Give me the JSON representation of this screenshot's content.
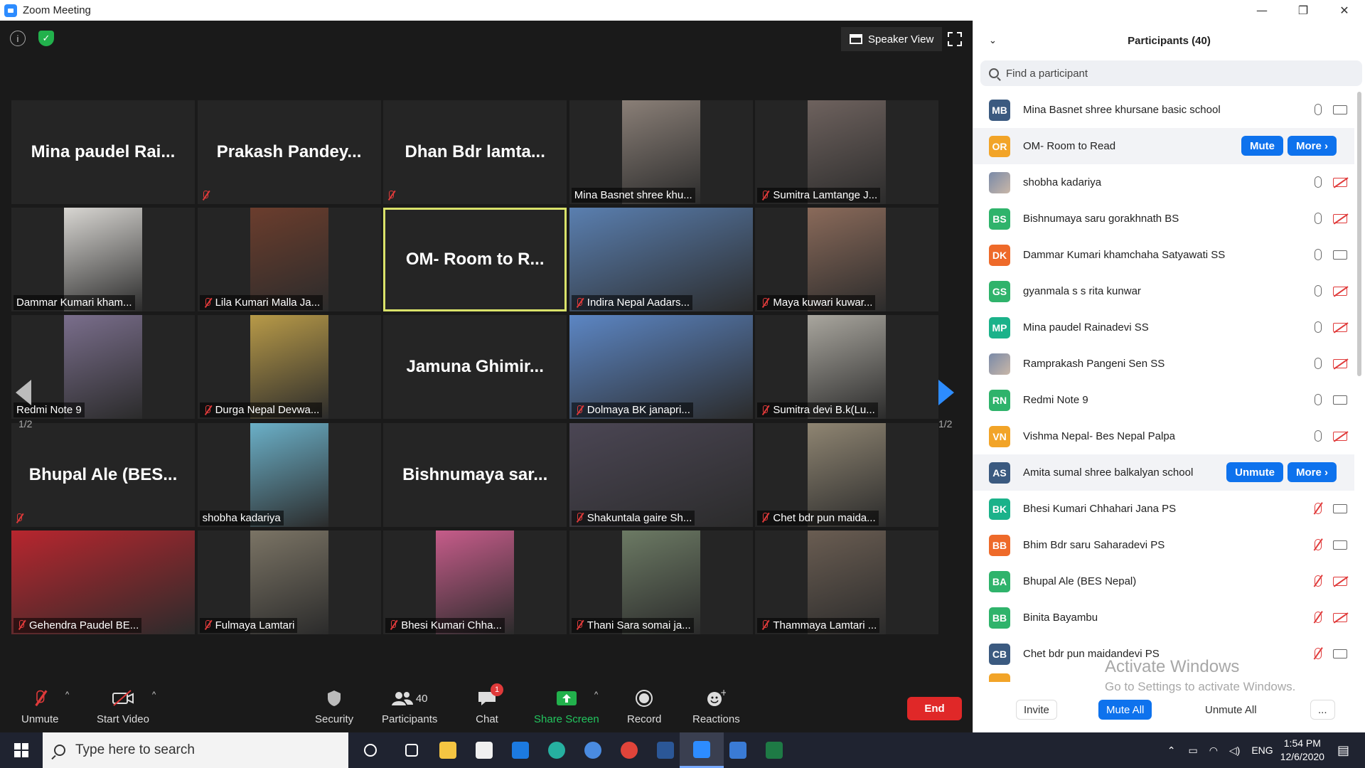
{
  "window": {
    "title": "Zoom Meeting",
    "min": "—",
    "max": "❐",
    "close": "✕"
  },
  "top": {
    "speaker_view": "Speaker View"
  },
  "pager": {
    "left": "1/2",
    "right": "1/2"
  },
  "tiles": [
    {
      "name": "Mina paudel Rai...",
      "label": "",
      "muted": false,
      "video": false
    },
    {
      "name": "Prakash Pandey...",
      "label": "",
      "muted": true,
      "video": false
    },
    {
      "name": "Dhan Bdr lamta...",
      "label": "",
      "muted": true,
      "video": false
    },
    {
      "name": "",
      "label": "Mina Basnet shree khu...",
      "muted": false,
      "video": true,
      "color": "#8a7f77"
    },
    {
      "name": "",
      "label": "Sumitra Lamtange J...",
      "muted": true,
      "video": true,
      "color": "#6e625e"
    },
    {
      "name": "",
      "label": "Dammar Kumari kham...",
      "muted": false,
      "video": true,
      "color": "#d8d6d2"
    },
    {
      "name": "",
      "label": "Lila Kumari Malla Ja...",
      "muted": true,
      "video": true,
      "color": "#6b3d2d"
    },
    {
      "name": "OM- Room to R...",
      "label": "",
      "muted": false,
      "video": false,
      "active": true
    },
    {
      "name": "",
      "label": "Indira Nepal Aadars...",
      "muted": true,
      "video": true,
      "color": "#5a7fb0"
    },
    {
      "name": "",
      "label": "Maya kuwari kuwar...",
      "muted": true,
      "video": true,
      "color": "#8a6a5a"
    },
    {
      "name": "",
      "label": "Redmi Note 9",
      "muted": false,
      "video": true,
      "color": "#7a6e8c"
    },
    {
      "name": "",
      "label": "Durga Nepal Devwa...",
      "muted": true,
      "video": true,
      "color": "#b89a48"
    },
    {
      "name": "Jamuna Ghimir...",
      "label": "",
      "muted": false,
      "video": false
    },
    {
      "name": "",
      "label": "Dolmaya BK janapri...",
      "muted": true,
      "video": true,
      "color": "#5c86c4"
    },
    {
      "name": "",
      "label": "Sumitra devi B.k(Lu...",
      "muted": true,
      "video": true,
      "color": "#a9a69e"
    },
    {
      "name": "Bhupal Ale (BES...",
      "label": "",
      "muted": true,
      "video": false
    },
    {
      "name": "",
      "label": "shobha kadariya",
      "muted": false,
      "video": true,
      "color": "#6bb0c8"
    },
    {
      "name": "Bishnumaya sar...",
      "label": "",
      "muted": false,
      "video": false
    },
    {
      "name": "",
      "label": "Shakuntala gaire Sh...",
      "muted": true,
      "video": true,
      "color": "#4b4654"
    },
    {
      "name": "",
      "label": "Chet bdr pun maida...",
      "muted": true,
      "video": true,
      "color": "#8f8572"
    },
    {
      "name": "",
      "label": "Gehendra Paudel BE...",
      "muted": true,
      "video": true,
      "color": "#b8262e"
    },
    {
      "name": "",
      "label": "Fulmaya Lamtari",
      "muted": true,
      "video": true,
      "color": "#7b7465"
    },
    {
      "name": "",
      "label": "Bhesi Kumari Chha...",
      "muted": true,
      "video": true,
      "color": "#c65c8a"
    },
    {
      "name": "",
      "label": "Thani Sara somai ja...",
      "muted": true,
      "video": true,
      "color": "#6c7a64"
    },
    {
      "name": "",
      "label": "Thammaya Lamtari ...",
      "muted": true,
      "video": true,
      "color": "#6a5d52"
    }
  ],
  "toolbar": {
    "unmute": "Unmute",
    "start_video": "Start Video",
    "security": "Security",
    "participants": "Participants",
    "participants_count": "40",
    "chat": "Chat",
    "chat_badge": "1",
    "share_screen": "Share Screen",
    "record": "Record",
    "reactions": "Reactions",
    "end": "End"
  },
  "panel": {
    "title": "Participants (40)",
    "search_placeholder": "Find a participant",
    "participants": [
      {
        "initials": "MB",
        "name": "Mina Basnet shree khursane basic school",
        "color": "#3b5a80",
        "mic": "on",
        "cam": "on"
      },
      {
        "initials": "OR",
        "name": "OM- Room to Read",
        "color": "#f2a428",
        "buttons": [
          "Mute",
          "More ›"
        ],
        "highlight": true
      },
      {
        "initials": "",
        "name": "shobha kadariya",
        "image": true,
        "mic": "on",
        "cam": "off"
      },
      {
        "initials": "BS",
        "name": "Bishnumaya saru gorakhnath BS",
        "color": "#2fb36b",
        "mic": "on",
        "cam": "off"
      },
      {
        "initials": "DK",
        "name": "Dammar Kumari khamchaha Satyawati SS",
        "color": "#ee6a2a",
        "mic": "on",
        "cam": "on"
      },
      {
        "initials": "GS",
        "name": "gyanmala s s rita kunwar",
        "color": "#2fb36b",
        "mic": "on",
        "cam": "off"
      },
      {
        "initials": "MP",
        "name": "Mina paudel Rainadevi SS",
        "color": "#1bb28a",
        "mic": "on",
        "cam": "off"
      },
      {
        "initials": "",
        "name": "Ramprakash Pangeni Sen SS",
        "image": true,
        "mic": "on",
        "cam": "off"
      },
      {
        "initials": "RN",
        "name": "Redmi Note 9",
        "color": "#2fb36b",
        "mic": "on",
        "cam": "on"
      },
      {
        "initials": "VN",
        "name": "Vishma Nepal- Bes Nepal Palpa",
        "color": "#f2a428",
        "mic": "on",
        "cam": "off"
      },
      {
        "initials": "AS",
        "name": "Amita sumal shree balkalyan school",
        "color": "#3b5a80",
        "buttons": [
          "Unmute",
          "More ›"
        ],
        "highlight": true
      },
      {
        "initials": "BK",
        "name": "Bhesi Kumari Chhahari Jana PS",
        "color": "#1bb28a",
        "mic": "off",
        "cam": "on"
      },
      {
        "initials": "BB",
        "name": "Bhim Bdr saru Saharadevi PS",
        "color": "#ee6a2a",
        "mic": "off",
        "cam": "on"
      },
      {
        "initials": "BA",
        "name": "Bhupal Ale (BES Nepal)",
        "color": "#2fb36b",
        "mic": "off",
        "cam": "off"
      },
      {
        "initials": "BB",
        "name": "Binita Bayambu",
        "color": "#2fb36b",
        "mic": "off",
        "cam": "off"
      },
      {
        "initials": "CB",
        "name": "Chet bdr pun maidandevi PS",
        "color": "#3b5a80",
        "mic": "off",
        "cam": "on"
      }
    ],
    "footer": {
      "invite": "Invite",
      "mute_all": "Mute All",
      "unmute_all": "Unmute All",
      "more": "..."
    },
    "watermark": {
      "line1": "Activate Windows",
      "line2": "Go to Settings to activate Windows."
    }
  },
  "taskbar": {
    "search_placeholder": "Type here to search",
    "lang": "ENG",
    "time": "1:54 PM",
    "date": "12/6/2020",
    "apps": [
      {
        "name": "task-view-icon",
        "color": "#ffffff"
      },
      {
        "name": "file-explorer-icon",
        "color": "#f5c542"
      },
      {
        "name": "store-icon",
        "color": "#f0f0f0"
      },
      {
        "name": "mail-icon",
        "color": "#1c7ae0"
      },
      {
        "name": "edge-icon",
        "color": "#26b0a0"
      },
      {
        "name": "chromium-icon",
        "color": "#4a8be0"
      },
      {
        "name": "chrome-icon",
        "color": "#e0443a"
      },
      {
        "name": "word-icon",
        "color": "#2b5797"
      },
      {
        "name": "zoom-icon",
        "color": "#2d8cff"
      },
      {
        "name": "photos-icon",
        "color": "#3a7bd5"
      },
      {
        "name": "excel-icon",
        "color": "#1e7a45"
      }
    ]
  }
}
